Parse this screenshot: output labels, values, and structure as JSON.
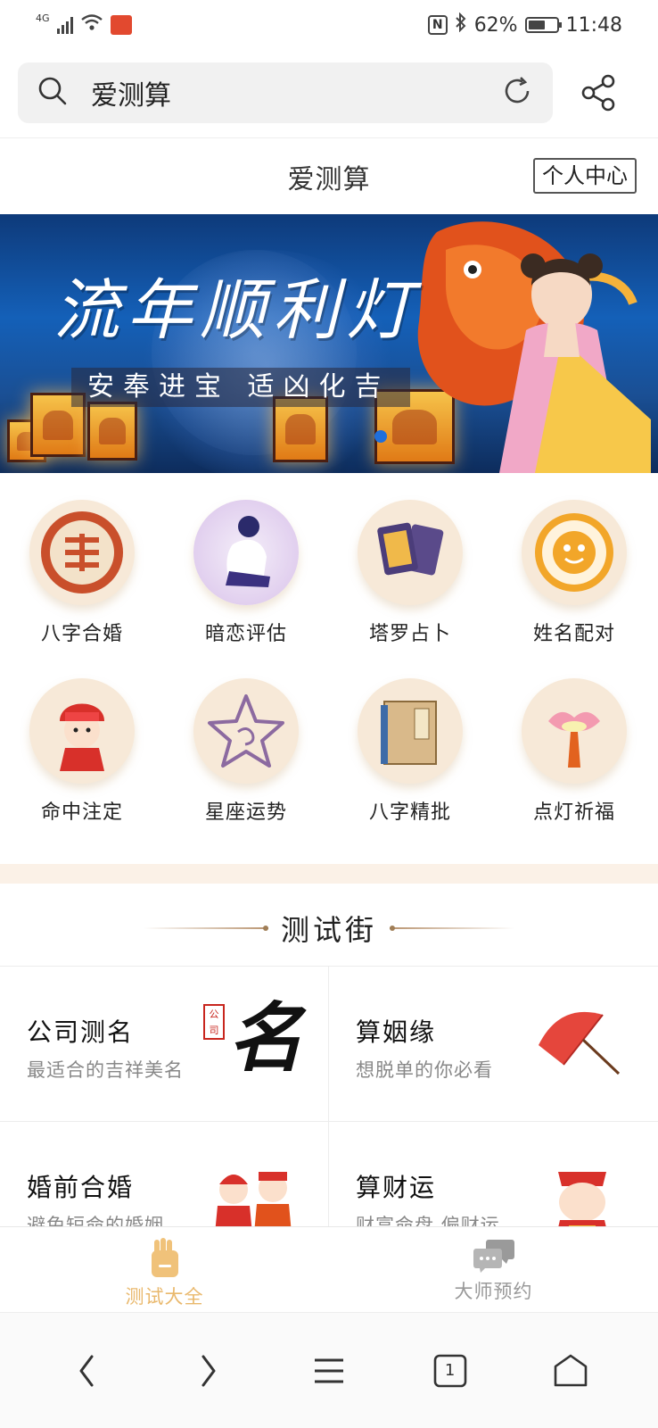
{
  "status_bar": {
    "network": "4G",
    "battery": "62%",
    "battery_level": 0.62,
    "time": "11:48"
  },
  "address_bar": {
    "text": "爱测算"
  },
  "header": {
    "title": "爱测算",
    "user_center": "个人中心"
  },
  "banner": {
    "title": "流年顺利灯",
    "subtitle": "安奉进宝 适凶化吉",
    "lantern_text": "流年顺利灯"
  },
  "grid_items": [
    {
      "label": "八字合婚",
      "icon": "double-happiness-icon"
    },
    {
      "label": "暗恋评估",
      "icon": "sad-figure-icon"
    },
    {
      "label": "塔罗占卜",
      "icon": "tarot-cards-icon"
    },
    {
      "label": "姓名配对",
      "icon": "bagua-icon"
    },
    {
      "label": "命中注定",
      "icon": "bride-icon"
    },
    {
      "label": "星座运势",
      "icon": "star-icon"
    },
    {
      "label": "八字精批",
      "icon": "book-icon"
    },
    {
      "label": "点灯祈福",
      "icon": "lotus-lamp-icon"
    }
  ],
  "section": {
    "title": "测试街"
  },
  "cards": [
    {
      "title": "公司测名",
      "subtitle": "最适合的吉祥美名",
      "art": "company-name-calligraphy",
      "art_seal": "公司",
      "art_char": "名"
    },
    {
      "title": "算姻缘",
      "subtitle": "想脱单的你必看",
      "art": "red-umbrella-icon"
    },
    {
      "title": "婚前合婚",
      "subtitle": "避免短命的婚姻",
      "art": "wedding-couple-icon"
    },
    {
      "title": "算财运",
      "subtitle": "财富命盘 偏财运",
      "art": "fortune-god-icon"
    }
  ],
  "tabbar": {
    "tabs": [
      {
        "label": "测试大全",
        "icon": "hand-icon",
        "active": true
      },
      {
        "label": "大师预约",
        "icon": "chat-bubbles-icon",
        "active": false
      }
    ]
  },
  "system_nav": {
    "tab_count": "1"
  },
  "colors": {
    "accent": "#e9b86c",
    "separator": "#fbf1e7",
    "banner_blue": "#1460b8",
    "indicator": "#1f6fdc"
  }
}
